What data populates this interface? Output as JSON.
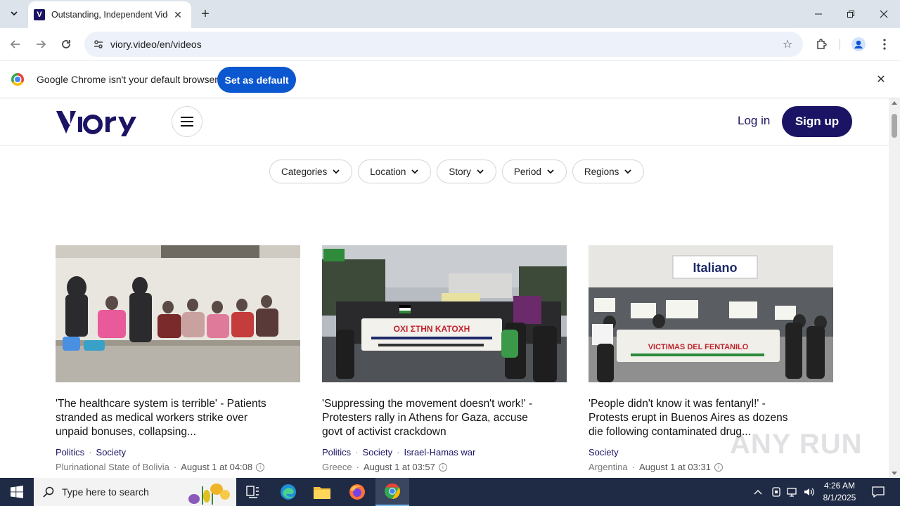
{
  "browser": {
    "tab_title": "Outstanding, Independent Vide",
    "url": "viory.video/en/videos",
    "infobar_text": "Google Chrome isn't your default browser",
    "infobar_button": "Set as default"
  },
  "site": {
    "login_label": "Log in",
    "signup_label": "Sign up",
    "filters": [
      "Categories",
      "Location",
      "Story",
      "Period",
      "Regions"
    ]
  },
  "cards": [
    {
      "title": "'The healthcare system is terrible' - Patients stranded as medical workers strike over unpaid bonuses, collapsing...",
      "tags": [
        "Politics",
        "Society"
      ],
      "location": "Plurinational State of Bolivia",
      "date": "August 1 at 04:08"
    },
    {
      "title": "'Suppressing the movement doesn't work!' - Protesters rally in Athens for Gaza, accuse govt of activist crackdown",
      "tags": [
        "Politics",
        "Society",
        "Israel-Hamas war"
      ],
      "location": "Greece",
      "date": "August 1 at 03:57",
      "banner_text": "ΟΧΙ ΣΤΗΝ ΚΑΤΟΧΗ"
    },
    {
      "title": "'People didn't know it was fentanyl!' - Protests erupt in Buenos Aires as dozens die following contaminated drug...",
      "tags": [
        "Society"
      ],
      "location": "Argentina",
      "date": "August 1 at 03:31",
      "sign_text": "Italiano",
      "banner_text": "VICTIMAS DEL FENTANILO"
    }
  ],
  "watermark": "ANY RUN",
  "taskbar": {
    "search_placeholder": "Type here to search",
    "time": "4:26 AM",
    "date": "8/1/2025"
  }
}
